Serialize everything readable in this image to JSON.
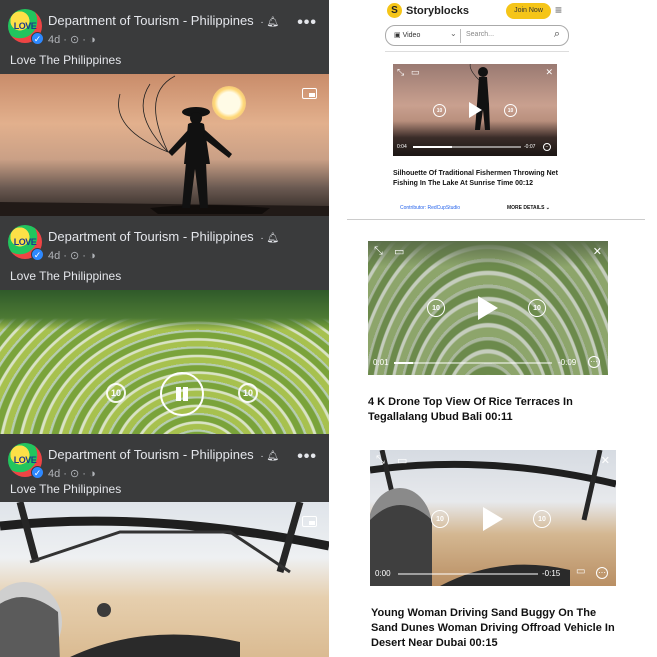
{
  "facebook": {
    "posts": [
      {
        "page_name": "Department of Tourism - Philippines",
        "meta": "4d · ⊙ · ◑",
        "caption": "Love The Philippines",
        "avatar_text": "LOVE"
      },
      {
        "page_name": "Department of Tourism - Philippines",
        "meta": "4d · ⊙ · ◑",
        "caption": "Love The Philippines",
        "avatar_text": "LOVE",
        "skip_back": "10",
        "skip_forward": "10"
      },
      {
        "page_name": "Department of Tourism - Philippines",
        "meta": "4d · ⊙ · ◑",
        "caption": "Love The Philippines",
        "avatar_text": "LOVE"
      }
    ],
    "more_label": "•••",
    "bell_icon": "bell-icon",
    "pip_icon": "picture-in-picture-icon"
  },
  "storyblocks": {
    "brand": "Storyblocks",
    "logo_letter": "S",
    "join_label": "Join Now",
    "search": {
      "category": "Video",
      "placeholder": "Search..."
    },
    "results": [
      {
        "time_start": "0:04",
        "time_end": "-0:07",
        "skip_back": "10",
        "skip_forward": "10",
        "title": "Silhouette Of Traditional Fishermen Throwing Net Fishing In The Lake At Sunrise Time 00:12",
        "contributor": "Contributor: RedCupStudio",
        "more_details": "MORE DETAILS ⌄",
        "progress": 0.36
      },
      {
        "time_start": "0:01",
        "time_end": "-0:09",
        "skip_back": "10",
        "skip_forward": "10",
        "title": "4 K Drone Top View Of Rice Terraces In Tegallalang Ubud Bali 00:11",
        "progress": 0.12
      },
      {
        "time_start": "0:00",
        "time_end": "-0:15",
        "skip_back": "10",
        "skip_forward": "10",
        "title": "Young Woman Driving Sand Buggy On The Sand Dunes Woman Driving Offroad Vehicle In Desert Near Dubai 00:15",
        "progress": 0.0
      }
    ]
  },
  "colors": {
    "fb_bg": "#242526",
    "fb_header": "#3a3b3c",
    "fb_text": "#e4e6eb",
    "verified": "#2d88ff",
    "storyblocks_yellow": "#f5c518"
  }
}
